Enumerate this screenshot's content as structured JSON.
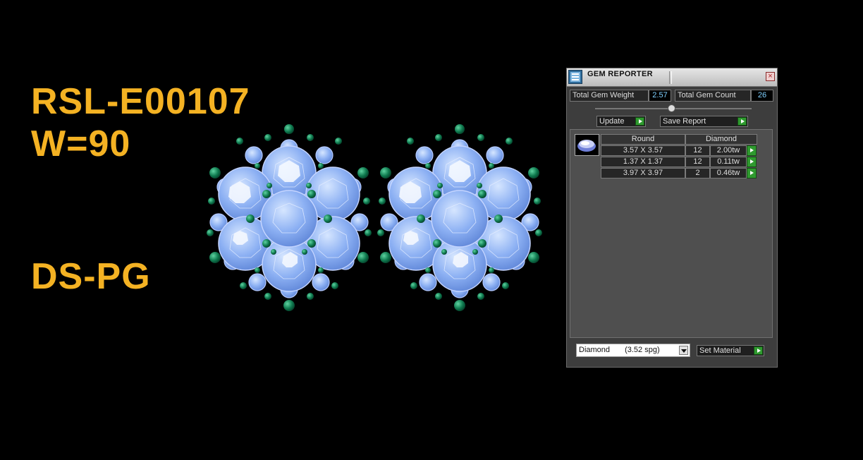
{
  "overlay": {
    "code": "RSL-E00107",
    "weight": "W=90",
    "type": "DS-PG",
    "text_color": "#f4b223"
  },
  "gem_reporter": {
    "title": "GEM REPORTER",
    "total_gem_weight_label": "Total Gem Weight",
    "total_gem_weight_value": "2.57",
    "total_gem_count_label": "Total Gem Count",
    "total_gem_count_value": "26",
    "update_label": "Update",
    "save_report_label": "Save Report",
    "table": {
      "col_shape": "Round",
      "col_material": "Diamond",
      "rows": [
        {
          "size": "3.57 X 3.57",
          "count": "12",
          "weight": "2.00tw"
        },
        {
          "size": "1.37 X 1.37",
          "count": "12",
          "weight": "0.11tw"
        },
        {
          "size": "3.97 X 3.97",
          "count": "2",
          "weight": "0.46tw"
        }
      ]
    },
    "material_select": {
      "name": "Diamond",
      "spg": "(3.52 spg)"
    },
    "set_material_label": "Set Material",
    "accent_color": "#2f9a2f"
  }
}
